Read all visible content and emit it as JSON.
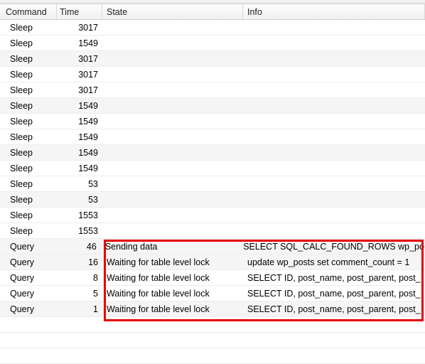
{
  "columns": {
    "command": "Command",
    "time": "Time",
    "state": "State",
    "info": "Info"
  },
  "rows": [
    {
      "command": "Sleep",
      "time": "3017",
      "state": "",
      "info": "",
      "alt": false
    },
    {
      "command": "Sleep",
      "time": "1549",
      "state": "",
      "info": "",
      "alt": false
    },
    {
      "command": "Sleep",
      "time": "3017",
      "state": "",
      "info": "",
      "alt": true
    },
    {
      "command": "Sleep",
      "time": "3017",
      "state": "",
      "info": "",
      "alt": false
    },
    {
      "command": "Sleep",
      "time": "3017",
      "state": "",
      "info": "",
      "alt": false
    },
    {
      "command": "Sleep",
      "time": "1549",
      "state": "",
      "info": "",
      "alt": true
    },
    {
      "command": "Sleep",
      "time": "1549",
      "state": "",
      "info": "",
      "alt": false
    },
    {
      "command": "Sleep",
      "time": "1549",
      "state": "",
      "info": "",
      "alt": false
    },
    {
      "command": "Sleep",
      "time": "1549",
      "state": "",
      "info": "",
      "alt": true
    },
    {
      "command": "Sleep",
      "time": "1549",
      "state": "",
      "info": "",
      "alt": false
    },
    {
      "command": "Sleep",
      "time": "53",
      "state": "",
      "info": "",
      "alt": false
    },
    {
      "command": "Sleep",
      "time": "53",
      "state": "",
      "info": "",
      "alt": true
    },
    {
      "command": "Sleep",
      "time": "1553",
      "state": "",
      "info": "",
      "alt": false
    },
    {
      "command": "Sleep",
      "time": "1553",
      "state": "",
      "info": "",
      "alt": false
    },
    {
      "command": "Query",
      "time": "46",
      "state": "Sending data",
      "info": "SELECT SQL_CALC_FOUND_ROWS  wp_po",
      "alt": true
    },
    {
      "command": "Query",
      "time": "16",
      "state": "Waiting for table level lock",
      "info": "update wp_posts set comment_count = 1",
      "alt": true
    },
    {
      "command": "Query",
      "time": "8",
      "state": "Waiting for table level lock",
      "info": "SELECT ID, post_name, post_parent, post_",
      "alt": false
    },
    {
      "command": "Query",
      "time": "5",
      "state": "Waiting for table level lock",
      "info": "SELECT ID, post_name, post_parent, post_",
      "alt": false
    },
    {
      "command": "Query",
      "time": "1",
      "state": "Waiting for table level lock",
      "info": "SELECT ID, post_name, post_parent, post_",
      "alt": true
    }
  ],
  "blank_rows": 3,
  "highlight": {
    "color": "#e60000"
  }
}
